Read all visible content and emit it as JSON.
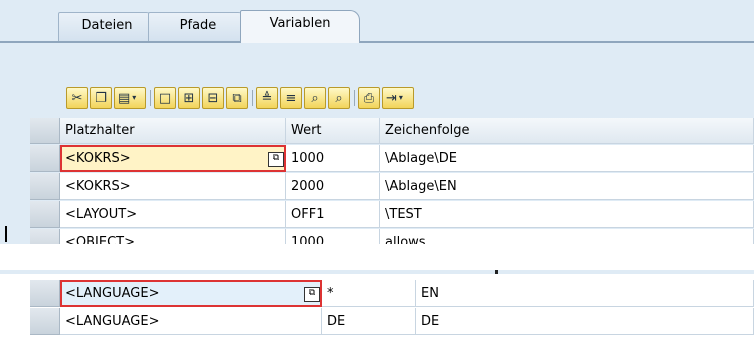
{
  "tabs": [
    {
      "label": "Dateien",
      "active": false
    },
    {
      "label": "Pfade",
      "active": false
    },
    {
      "label": "Variablen",
      "active": true
    }
  ],
  "toolbar": {
    "buttons": [
      {
        "icon": "cut-icon"
      },
      {
        "icon": "copy-icon"
      },
      {
        "icon": "paste-icon",
        "dropdown": true
      },
      {
        "icon": "new-row-icon"
      },
      {
        "icon": "insert-row-icon"
      },
      {
        "icon": "delete-row-icon"
      },
      {
        "icon": "duplicate-row-icon"
      },
      {
        "icon": "sort-ascending-icon"
      },
      {
        "icon": "filter-icon"
      },
      {
        "icon": "find-icon"
      },
      {
        "icon": "find-next-icon"
      },
      {
        "icon": "print-icon"
      },
      {
        "icon": "export-icon",
        "dropdown": true
      }
    ]
  },
  "grid": {
    "columns": [
      "Platzhalter",
      "Wert",
      "Zeichenfolge"
    ],
    "rows": [
      {
        "placeholder": "<KOKRS>",
        "value": "1000",
        "string": "\\Ablage\\DE",
        "focused": true
      },
      {
        "placeholder": "<KOKRS>",
        "value": "2000",
        "string": "\\Ablage\\EN"
      },
      {
        "placeholder": "<LAYOUT>",
        "value": "OFF1",
        "string": "\\TEST"
      },
      {
        "placeholder": "<OBJECT>",
        "value": "1000",
        "string": "allows"
      }
    ]
  },
  "grid2": {
    "rows": [
      {
        "placeholder": "<LANGUAGE>",
        "value": "*",
        "string": "EN",
        "focused": true
      },
      {
        "placeholder": "<LANGUAGE>",
        "value": "DE",
        "string": "DE"
      }
    ]
  },
  "colors": {
    "window_bg": "#dfebf5",
    "focus_cell": "#fff3c6",
    "highlight_border": "#dd3333",
    "toolbar_button": "#f2d45a"
  }
}
